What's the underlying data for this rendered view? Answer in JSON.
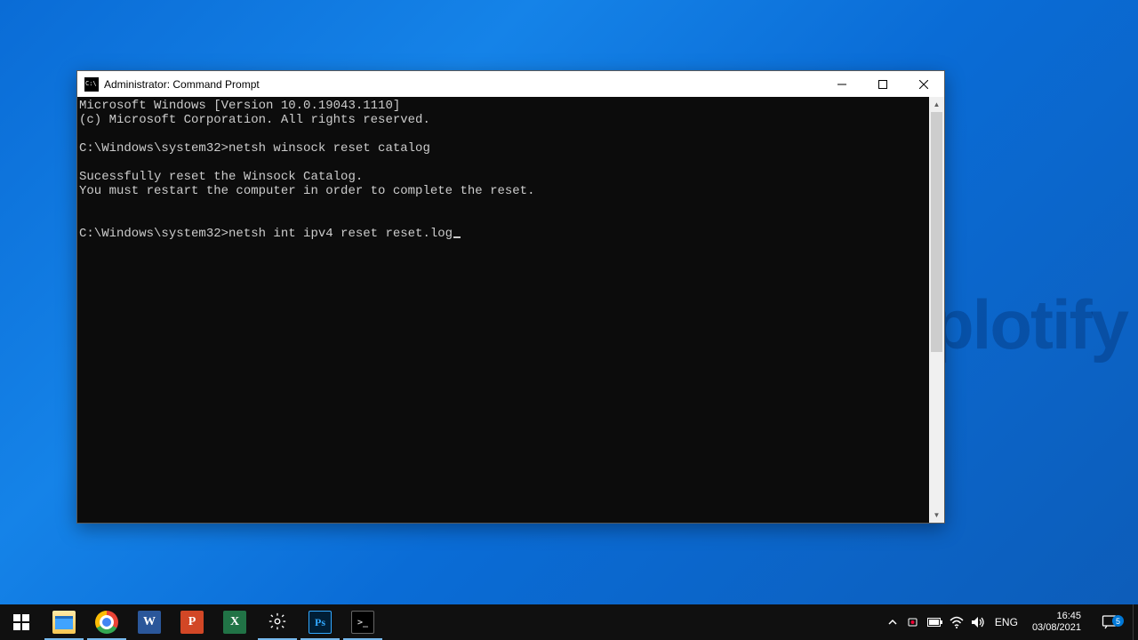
{
  "watermark": "uplotify",
  "window": {
    "title": "Administrator: Command Prompt"
  },
  "console": {
    "lines": [
      "Microsoft Windows [Version 10.0.19043.1110]",
      "(c) Microsoft Corporation. All rights reserved.",
      "",
      "C:\\Windows\\system32>netsh winsock reset catalog",
      "",
      "Sucessfully reset the Winsock Catalog.",
      "You must restart the computer in order to complete the reset.",
      "",
      "",
      "C:\\Windows\\system32>netsh int ipv4 reset reset.log"
    ]
  },
  "taskbar": {
    "apps": [
      {
        "name": "start",
        "kind": "start"
      },
      {
        "name": "file-explorer",
        "kind": "explorer",
        "state": "active"
      },
      {
        "name": "google-chrome",
        "kind": "chrome",
        "state": "active"
      },
      {
        "name": "word",
        "kind": "word",
        "letter": "W"
      },
      {
        "name": "powerpoint",
        "kind": "ppt",
        "letter": "P"
      },
      {
        "name": "excel",
        "kind": "excel",
        "letter": "X"
      },
      {
        "name": "settings",
        "kind": "settings",
        "state": "active"
      },
      {
        "name": "photoshop",
        "kind": "ps",
        "letter": "Ps",
        "state": "active"
      },
      {
        "name": "command-prompt",
        "kind": "cmd",
        "state": "active"
      }
    ],
    "tray": {
      "lang": "ENG",
      "time": "16:45",
      "date": "03/08/2021",
      "notif_count": "5"
    }
  }
}
